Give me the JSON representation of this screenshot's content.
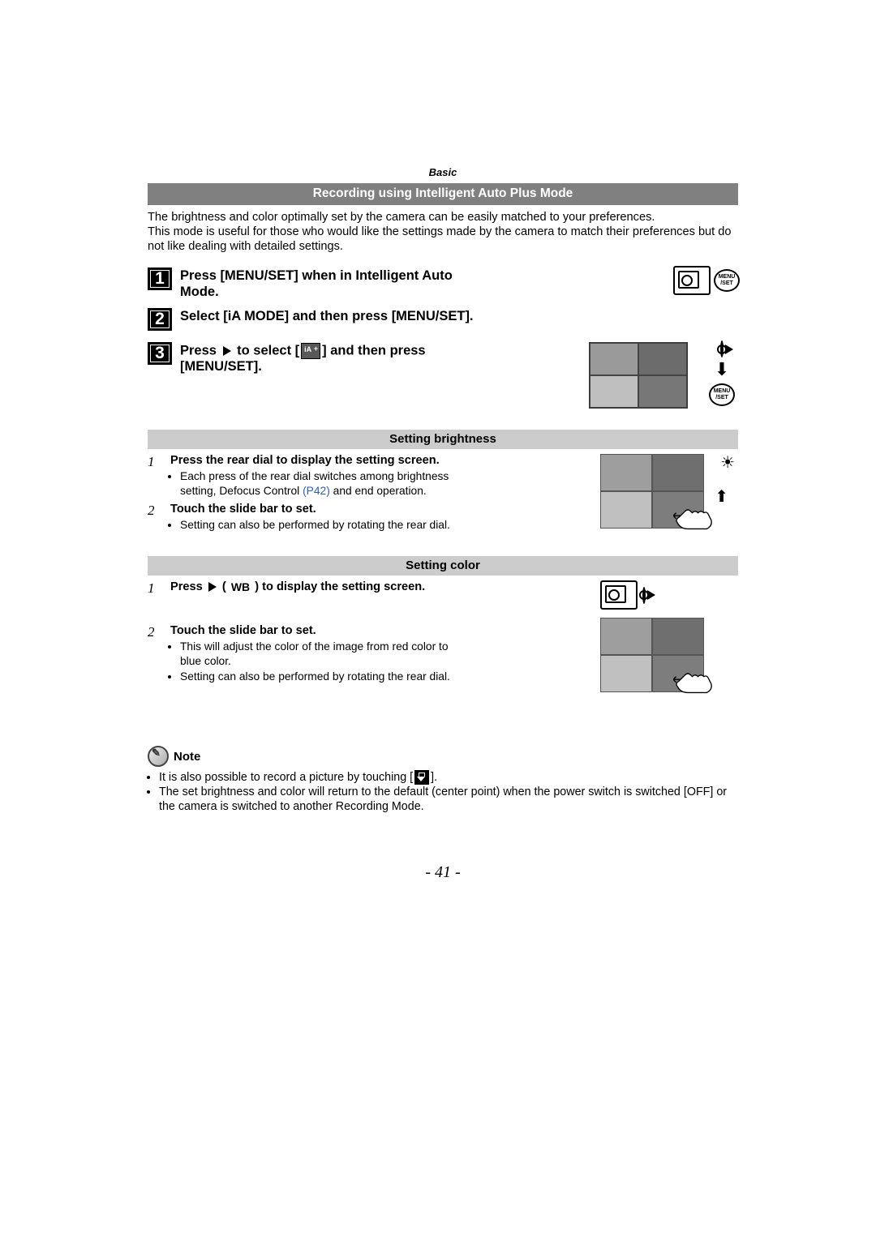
{
  "header": {
    "section": "Basic"
  },
  "title": "Recording using Intelligent Auto Plus Mode",
  "intro": "The brightness and color optimally set by the camera can be easily matched to your preferences.\nThis mode is useful for those who would like to make the settings made by the camera to match their preferences but do not like dealing with detailed settings.",
  "steps": [
    {
      "num": "1",
      "text": "Press [MENU/SET] when in Intelligent Auto Mode."
    },
    {
      "num": "2",
      "text": "Select [iA MODE] and then press [MENU/SET]."
    },
    {
      "num": "3",
      "text_before": "Press ",
      "text_mid": " to select [",
      "text_after": "] and then press [MENU/SET]."
    }
  ],
  "menu_label": "MENU\n/SET",
  "brightness": {
    "title": "Setting brightness",
    "steps": [
      {
        "num": "1",
        "bold": "Press the rear dial to display the setting screen.",
        "bullets": [
          "Each press of the rear dial switches among brightness setting, Defocus Control (P42) and end operation."
        ],
        "link_text": "(P42)"
      },
      {
        "num": "2",
        "bold": "Touch the slide bar to set.",
        "bullets": [
          "Setting can also be performed by rotating the rear dial."
        ]
      }
    ]
  },
  "color": {
    "title": "Setting color",
    "steps": [
      {
        "num": "1",
        "bold_before": "Press ",
        "bold_mid": " ( ",
        "bold_wb": "WB",
        "bold_after": " ) to display the setting screen."
      },
      {
        "num": "2",
        "bold": "Touch the slide bar to set.",
        "bullets": [
          "This will adjust the color of the image from red color to blue color.",
          "Setting can also be performed by rotating the rear dial."
        ]
      }
    ]
  },
  "note": {
    "title": "Note",
    "bullets_before": "It is also possible to record a picture by touching [",
    "bullets_after": "].",
    "bullets_2": "The set brightness and color will return to the default (center point) when the power switch is switched [OFF] or the camera is switched to another Recording Mode."
  },
  "page_number": "- 41 -"
}
